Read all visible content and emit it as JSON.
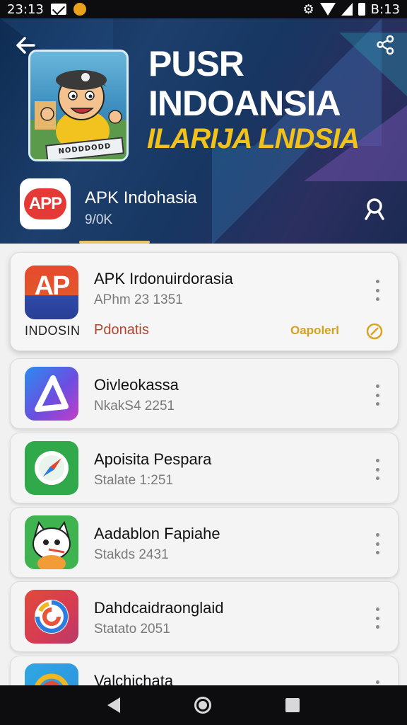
{
  "status_bar": {
    "time_left": "23:13",
    "time_right": "B:13",
    "icons": [
      "mail-icon",
      "coin-icon",
      "settings-icon",
      "wifi-icon",
      "signal-icon",
      "battery-icon"
    ]
  },
  "header": {
    "hero_title_line1": "PUSR",
    "hero_title_line2": "INDOANSIA",
    "hero_subtitle": "ILARIJA LNDSIA",
    "hero_sign_text": "NODDDODD",
    "app_logo_text": "APP",
    "app_name": "APK Indohasia",
    "app_count": "9/0K",
    "icons": {
      "back": "back-arrow-icon",
      "share": "share-icon",
      "search": "search-icon"
    }
  },
  "list": {
    "featured": {
      "icon_text": "AP",
      "icon_subtext": "INDOSIN",
      "title": "APK Irdonuirdorasia",
      "subtitle": "APhm 23 1351",
      "brand": "INDOSIN",
      "tag": "Pdonatis",
      "action": "Oapolerl"
    },
    "items": [
      {
        "title": "Oivleokassa",
        "subtitle": "NkakS4 2251"
      },
      {
        "title": "Apoisita Pespara",
        "subtitle": "Stalate 1:251"
      },
      {
        "title": "Aadablon Fapiahe",
        "subtitle": "Stakds 2431"
      },
      {
        "title": "Dahdcaidraonglaid",
        "subtitle": "Statato 2051"
      },
      {
        "title": "Valchichata",
        "subtitle": ""
      }
    ]
  },
  "colors": {
    "accent_red": "#e53935",
    "accent_yellow": "#f2c21b",
    "header_dark": "#173661"
  }
}
